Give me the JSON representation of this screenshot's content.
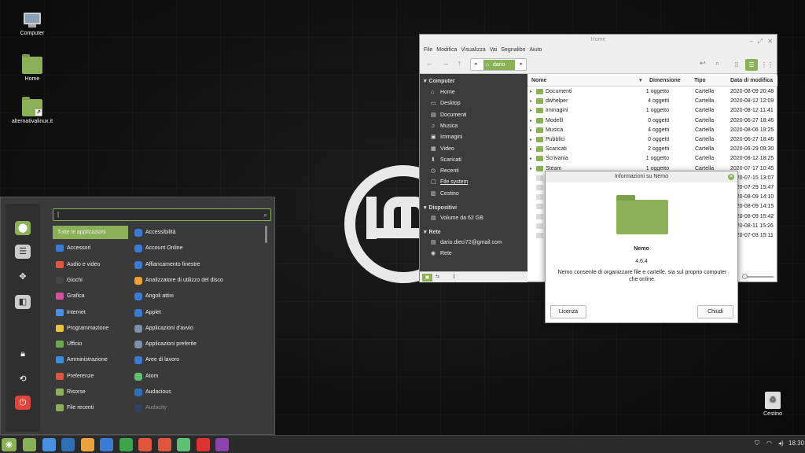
{
  "desktop": {
    "icons": [
      {
        "label": "Computer",
        "icon": "computer-icon"
      },
      {
        "label": "Home",
        "icon": "folder-icon"
      },
      {
        "label": "alternativalinux.it",
        "icon": "folder-link-icon"
      },
      {
        "label": "Cestino",
        "icon": "trash-icon"
      }
    ]
  },
  "menu": {
    "search_value": "|",
    "categories": [
      "Tutte le applicazioni",
      "Accessori",
      "Audio e video",
      "Giochi",
      "Grafica",
      "Internet",
      "Programmazione",
      "Ufficio",
      "Amministrazione",
      "Preferenze",
      "Risorse",
      "File recenti"
    ],
    "apps": [
      "Accessibilità",
      "Account Online",
      "Affiancamento finestre",
      "Analizzatore di utilizzo del disco",
      "Angoli attivi",
      "Applet",
      "Applicazioni d'avvio",
      "Applicazioni preferite",
      "Aree di lavoro",
      "Atom",
      "Audacious",
      "Audacity"
    ],
    "category_colors": [
      "#8bb158",
      "#3a7bd5",
      "#e0553d",
      "#444",
      "#d84fa0",
      "#4a90e2",
      "#e8c43a",
      "#6aa84f",
      "#3b8de0",
      "#e0553d",
      "#8bb158",
      "#8bb158"
    ],
    "app_colors": [
      "#3a7bd5",
      "#3a7bd5",
      "#3a7bd5",
      "#f0a030",
      "#3a7bd5",
      "#3a7bd5",
      "#7a8fa8",
      "#7a8fa8",
      "#3a7bd5",
      "#5fbf73",
      "#2f6fb5",
      "#2a4b8a"
    ]
  },
  "filemanager": {
    "title": "Home",
    "menubar": [
      "File",
      "Modifica",
      "Visualizza",
      "Vai",
      "Segnalibri",
      "Aiuto"
    ],
    "breadcrumb": "dario",
    "sidebar": {
      "computer_header": "Computer",
      "computer_items": [
        "Home",
        "Desktop",
        "Documenti",
        "Musica",
        "Immagini",
        "Video",
        "Scaricati",
        "Recenti",
        "File system",
        "Cestino"
      ],
      "devices_header": "Dispositivi",
      "devices_items": [
        "Volume da 62 GB"
      ],
      "network_header": "Rete",
      "network_items": [
        "dario.dieci72@gmail.com",
        "Rete"
      ]
    },
    "columns": [
      "Nome",
      "Dimensione",
      "Tipo",
      "Data di modifica"
    ],
    "rows": [
      {
        "name": "Documenti",
        "size": "1 oggetto",
        "type": "Cartella",
        "date": "2020-08-09 20:48"
      },
      {
        "name": "dwhelper",
        "size": "4 oggetti",
        "type": "Cartella",
        "date": "2020-08-12 12:09"
      },
      {
        "name": "Immagini",
        "size": "1 oggetto",
        "type": "Cartella",
        "date": "2020-08-12 11:41"
      },
      {
        "name": "Modelli",
        "size": "0 oggetti",
        "type": "Cartella",
        "date": "2020-06-27 18:46"
      },
      {
        "name": "Musica",
        "size": "4 oggetti",
        "type": "Cartella",
        "date": "2020-08-06 19:25"
      },
      {
        "name": "Pubblici",
        "size": "0 oggetti",
        "type": "Cartella",
        "date": "2020-06-27 18:46"
      },
      {
        "name": "Scaricati",
        "size": "2 oggetti",
        "type": "Cartella",
        "date": "2020-06-29 09:30"
      },
      {
        "name": "Scrivania",
        "size": "1 oggetto",
        "type": "Cartella",
        "date": "2020-08-12 18:25"
      },
      {
        "name": "Steam",
        "size": "1 oggetto",
        "type": "Cartella",
        "date": "2020-07-17 10:45"
      },
      {
        "name": "",
        "size": "",
        "type": "",
        "date": "2020-07-15 13:07"
      },
      {
        "name": "",
        "size": "",
        "type": "",
        "date": "2020-07-29 15:47"
      },
      {
        "name": "",
        "size": "",
        "type": "",
        "date": "2020-08-09 14:10"
      },
      {
        "name": "",
        "size": "",
        "type": "",
        "date": "2020-08-09 14:15"
      },
      {
        "name": "",
        "size": "",
        "type": "",
        "date": "2020-08-09 15:42"
      },
      {
        "name": "",
        "size": "",
        "type": "",
        "date": "2020-08-11 15:26"
      },
      {
        "name": "",
        "size": "",
        "type": "",
        "date": "2020-07-03 15:11"
      }
    ]
  },
  "dialog": {
    "title": "Informazioni su Nemo",
    "app_name": "Nemo",
    "version": "4.6.4",
    "description": "Nemo consente di organizzare file e cartelle, sia sul proprio computer che online.",
    "license_button": "Licenza",
    "close_button": "Chiudi"
  },
  "taskbar": {
    "clock": "18.30",
    "launcher_colors": [
      "#8bb158",
      "#8bb158",
      "#4a90e2",
      "#2f6fb5",
      "#e8a33a",
      "#3a7bd5",
      "#3fa34d",
      "#e0553d",
      "#e0553d",
      "#5fbf73",
      "#d33",
      "#8e44ad"
    ]
  }
}
